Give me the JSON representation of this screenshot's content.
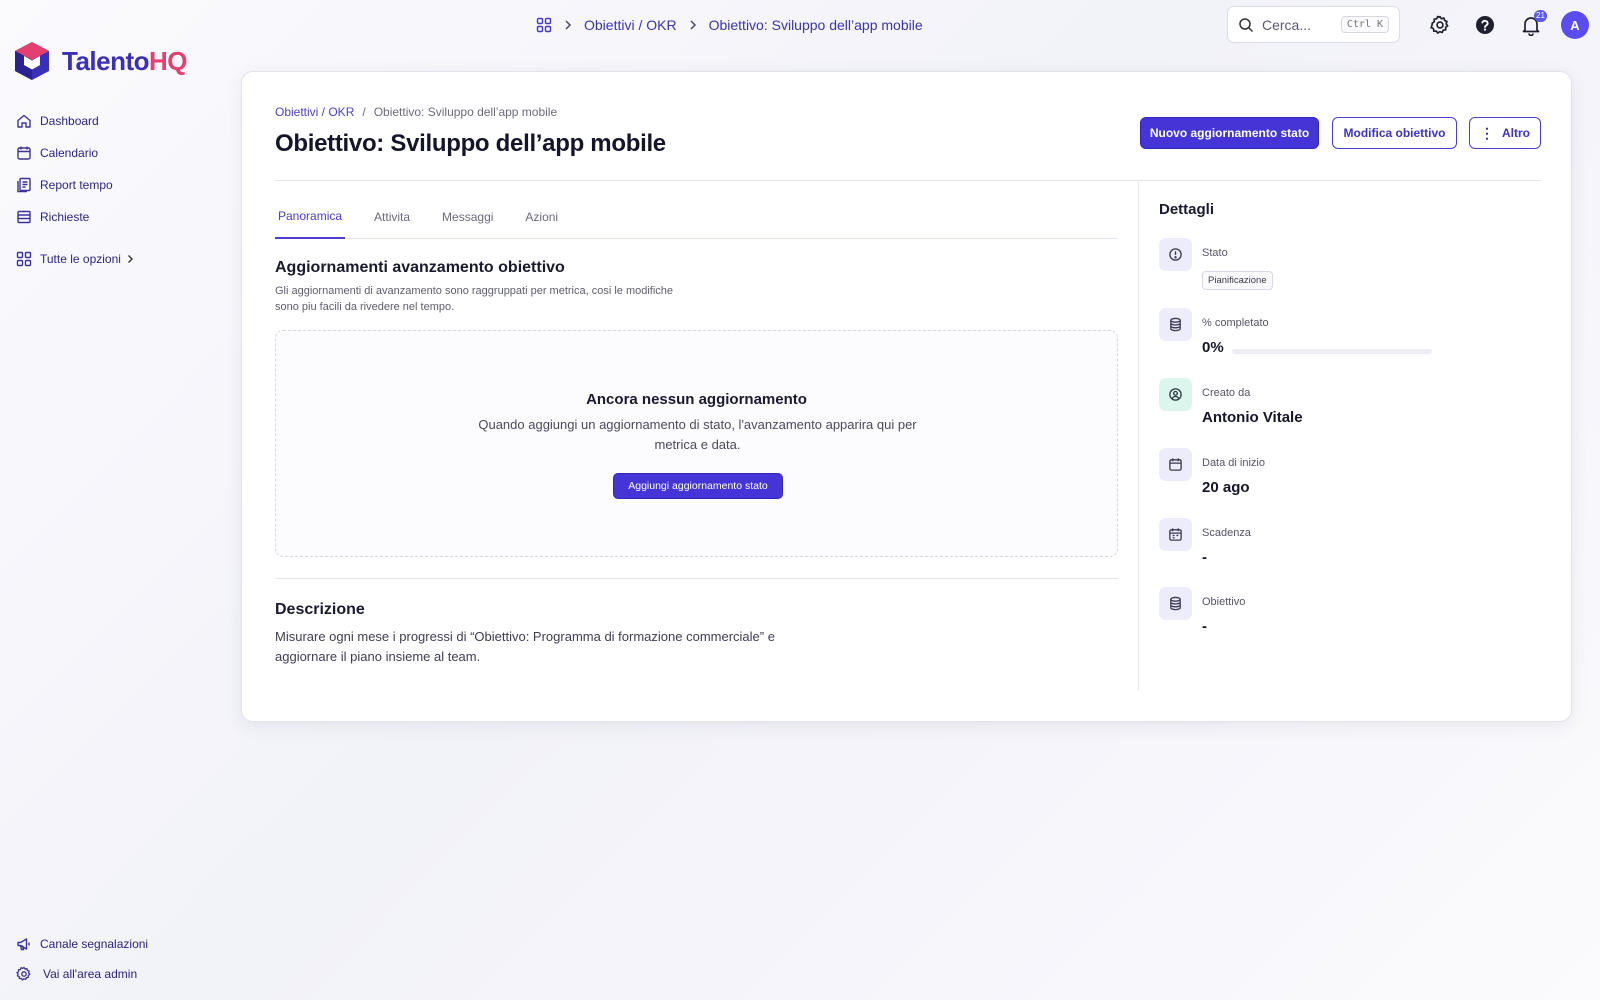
{
  "app": {
    "logo_part1": "Talento",
    "logo_part2": "HQ"
  },
  "topbar": {
    "crumbs": [
      "Obiettivi / OKR",
      "Obiettivo: Sviluppo dell’app mobile"
    ],
    "search_placeholder": "Cerca...",
    "search_shortcut": "Ctrl K",
    "notification_count": "21",
    "avatar_initial": "A"
  },
  "sidebar": {
    "items": [
      {
        "label": "Dashboard",
        "icon": "home-icon"
      },
      {
        "label": "Calendario",
        "icon": "calendar-icon"
      },
      {
        "label": "Report tempo",
        "icon": "report-icon"
      },
      {
        "label": "Richieste",
        "icon": "list-icon"
      }
    ],
    "all_options": "Tutte le opzioni",
    "bottom": [
      {
        "label": "Canale segnalazioni",
        "icon": "megaphone-icon"
      },
      {
        "label": "Vai all'area admin",
        "icon": "gear-icon"
      }
    ]
  },
  "page": {
    "breadcrumb": [
      "Obiettivi / OKR",
      "/",
      "Obiettivo: Sviluppo dell’app mobile"
    ],
    "title": "Obiettivo: Sviluppo dell’app mobile",
    "actions": {
      "primary": "Nuovo aggiornamento stato",
      "edit": "Modifica obiettivo",
      "more": "Altro"
    },
    "tabs": [
      "Panoramica",
      "Attivita",
      "Messaggi",
      "Azioni"
    ],
    "active_tab": "Panoramica"
  },
  "updates": {
    "title": "Aggiornamenti avanzamento obiettivo",
    "subtitle": "Gli aggiornamenti di avanzamento sono raggruppati per metrica, cosi le modifiche sono piu facili da rivedere nel tempo.",
    "empty_title": "Ancora nessun aggiornamento",
    "empty_text": "Quando aggiungi un aggiornamento di stato, l'avanzamento apparira qui per metrica e data.",
    "empty_button": "Aggiungi aggiornamento stato"
  },
  "description": {
    "title": "Descrizione",
    "text": "Misurare ogni mese i progressi di “Obiettivo: Programma di formazione commerciale” e aggiornare il piano insieme al team."
  },
  "details": {
    "title": "Dettagli",
    "status_label": "Stato",
    "status_value": "Pianificazione",
    "completion_label": "% completato",
    "completion_value": "0%",
    "completion_fraction": 0,
    "created_label": "Creato da",
    "created_value": "Antonio Vitale",
    "start_label": "Data di inizio",
    "start_value": "20 ago",
    "deadline_label": "Scadenza",
    "deadline_value": "-",
    "target_label": "Obiettivo",
    "target_value": "-"
  },
  "colors": {
    "accent": "#4535d6",
    "brand_dark": "#3a2fb8",
    "brand_pink": "#e3406f"
  }
}
